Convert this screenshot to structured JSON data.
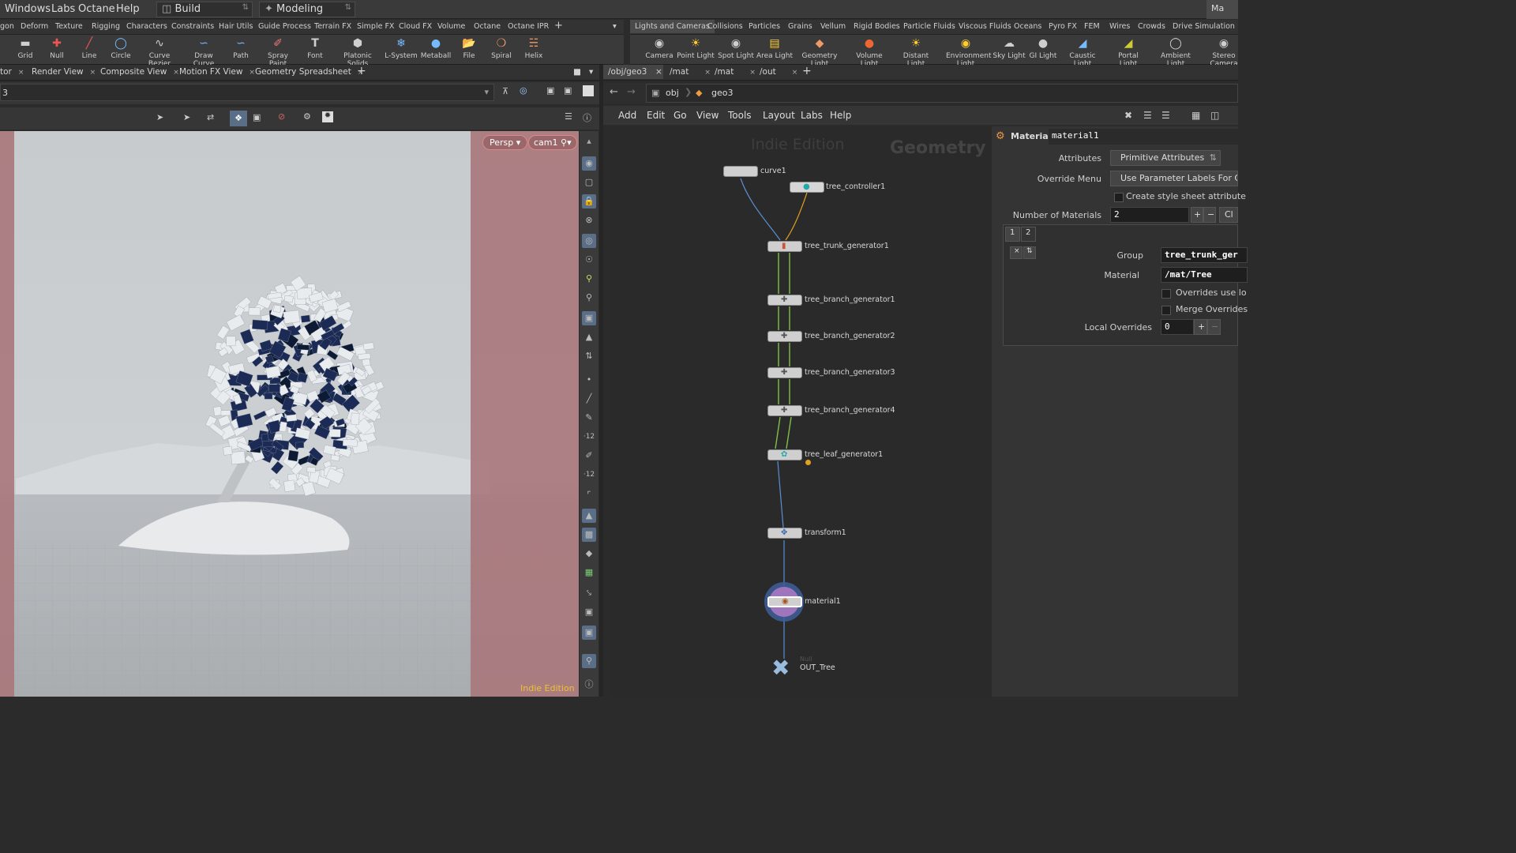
{
  "menubar": {
    "items": [
      "Windows",
      "Labs",
      "Octane",
      "Help"
    ],
    "desktop": "Build",
    "context": "Modeling",
    "right_label": "Ma"
  },
  "shelf_left": {
    "tabs": [
      "gon",
      "Deform",
      "Texture",
      "Rigging",
      "Characters",
      "Constraints",
      "Hair Utils",
      "Guide Process",
      "Terrain FX",
      "Simple FX",
      "Cloud FX",
      "Volume",
      "Octane",
      "Octane IPR"
    ],
    "tools": [
      "Grid",
      "Null",
      "Line",
      "Circle",
      "Curve Bezier",
      "Draw Curve",
      "Path",
      "Spray Paint",
      "Font",
      "Platonic Solids",
      "L-System",
      "Metaball",
      "File",
      "Spiral",
      "Helix"
    ]
  },
  "shelf_right": {
    "tabs": [
      "Lights and Cameras",
      "Collisions",
      "Particles",
      "Grains",
      "Vellum",
      "Rigid Bodies",
      "Particle Fluids",
      "Viscous Fluids",
      "Oceans",
      "Pyro FX",
      "FEM",
      "Wires",
      "Crowds",
      "Drive Simulation"
    ],
    "tools": [
      "Camera",
      "Point Light",
      "Spot Light",
      "Area Light",
      "Geometry Light",
      "Volume Light",
      "Distant Light",
      "Environment Light",
      "Sky Light",
      "GI Light",
      "Caustic Light",
      "Portal Light",
      "Ambient Light",
      "Stereo Camera"
    ]
  },
  "viewer": {
    "tabs": [
      "tor",
      "Render View",
      "Composite View",
      "Motion FX View",
      "Geometry Spreadsheet"
    ],
    "path": "3",
    "persp": "Persp",
    "camera": "cam1",
    "watermark": "Indie Edition"
  },
  "network": {
    "tabs": [
      "/obj/geo3",
      "/mat",
      "/mat",
      "/out"
    ],
    "path": [
      "obj",
      "geo3"
    ],
    "menu": [
      "Add",
      "Edit",
      "Go",
      "View",
      "Tools",
      "Layout",
      "Labs",
      "Help"
    ],
    "watermark": "Indie Edition",
    "context_label": "Geometry",
    "nodes": [
      "curve1",
      "tree_controller1",
      "tree_trunk_generator1",
      "tree_branch_generator1",
      "tree_branch_generator2",
      "tree_branch_generator3",
      "tree_branch_generator4",
      "tree_leaf_generator1",
      "transform1",
      "material1",
      "OUT_Tree"
    ],
    "null_label": "Null"
  },
  "params": {
    "type": "Material",
    "name": "material1",
    "attributes_label": "Attributes",
    "attributes_value": "Primitive Attributes",
    "override_label": "Override Menu",
    "override_value": "Use Parameter Labels For Ove",
    "style_sheet": "Create style sheet attribute",
    "num_label": "Number of Materials",
    "num_value": "2",
    "clear": "Cl",
    "tab1": "1",
    "tab2": "2",
    "group_label": "Group",
    "group_value": "tree_trunk_ger",
    "material_label": "Material",
    "material_value": "/mat/Tree",
    "overrides_local": "Overrides use lo",
    "merge": "Merge Overrides",
    "local_label": "Local Overrides",
    "local_value": "0"
  },
  "colors": {
    "accent": "#5a6e88",
    "wire_green": "#7ec24a",
    "wire_blue": "#5a8fd6",
    "wire_orange": "#e0a020",
    "mask": "#a8777b"
  }
}
